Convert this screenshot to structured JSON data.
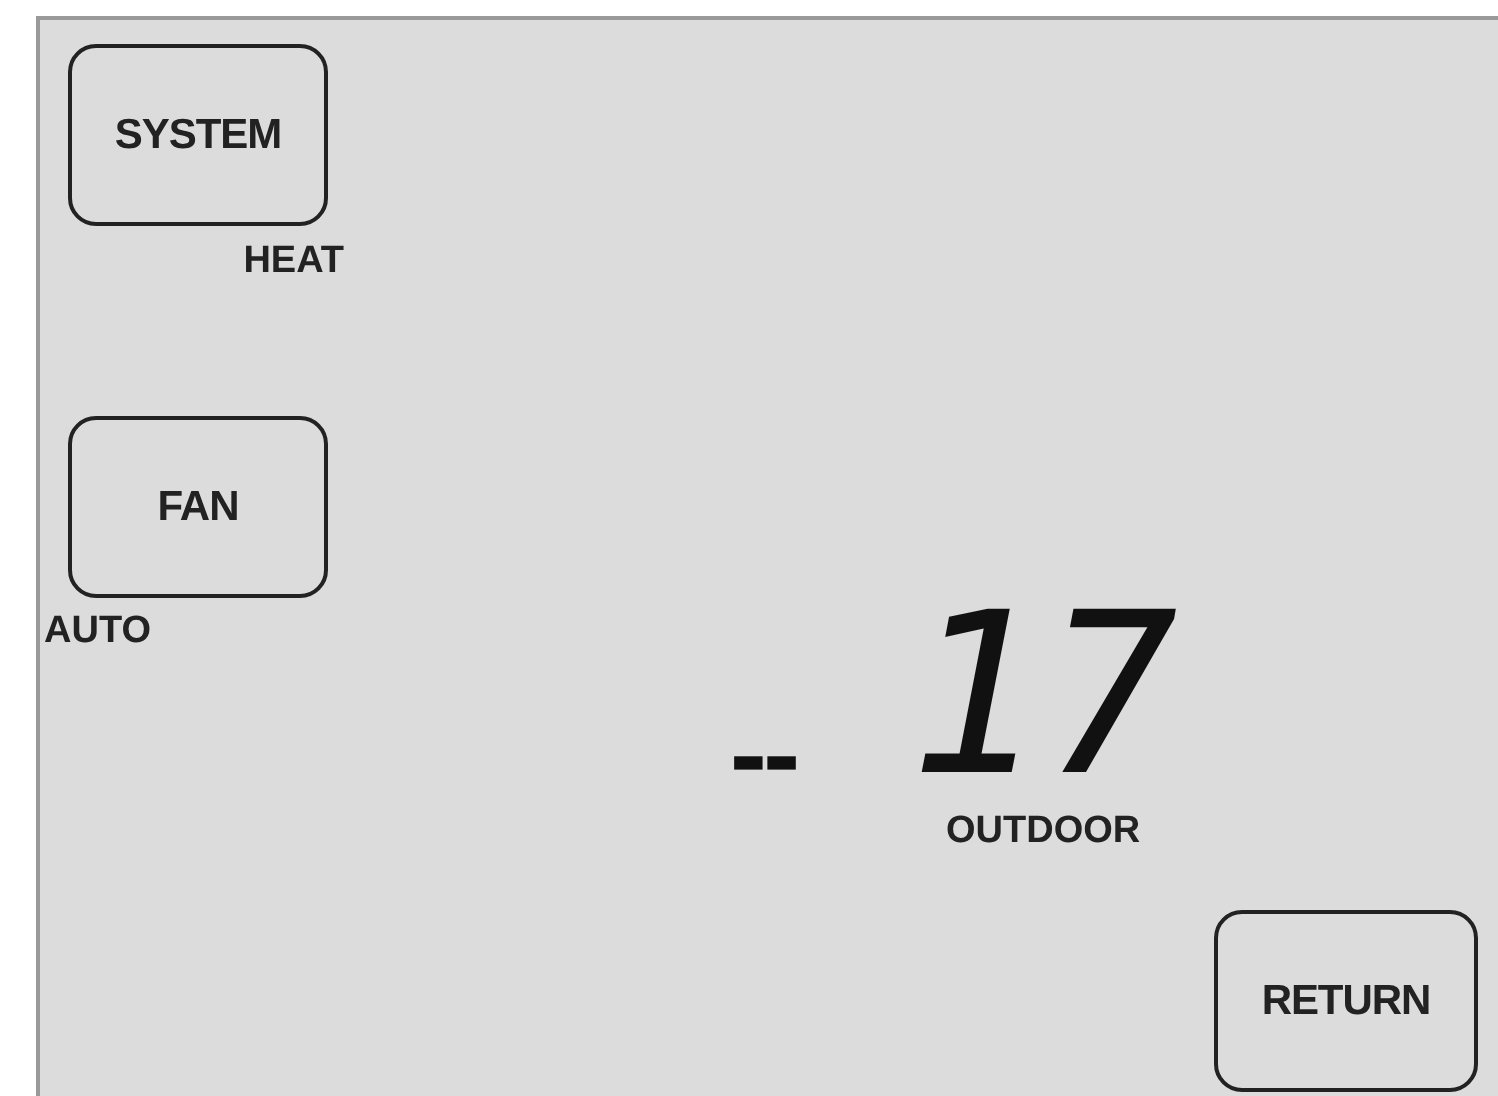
{
  "system": {
    "button": "SYSTEM",
    "mode": "HEAT"
  },
  "fan": {
    "button": "FAN",
    "mode": "AUTO"
  },
  "readout": {
    "prefix": "--",
    "value": "17",
    "label": "OUTDOOR"
  },
  "return_button": "RETURN"
}
